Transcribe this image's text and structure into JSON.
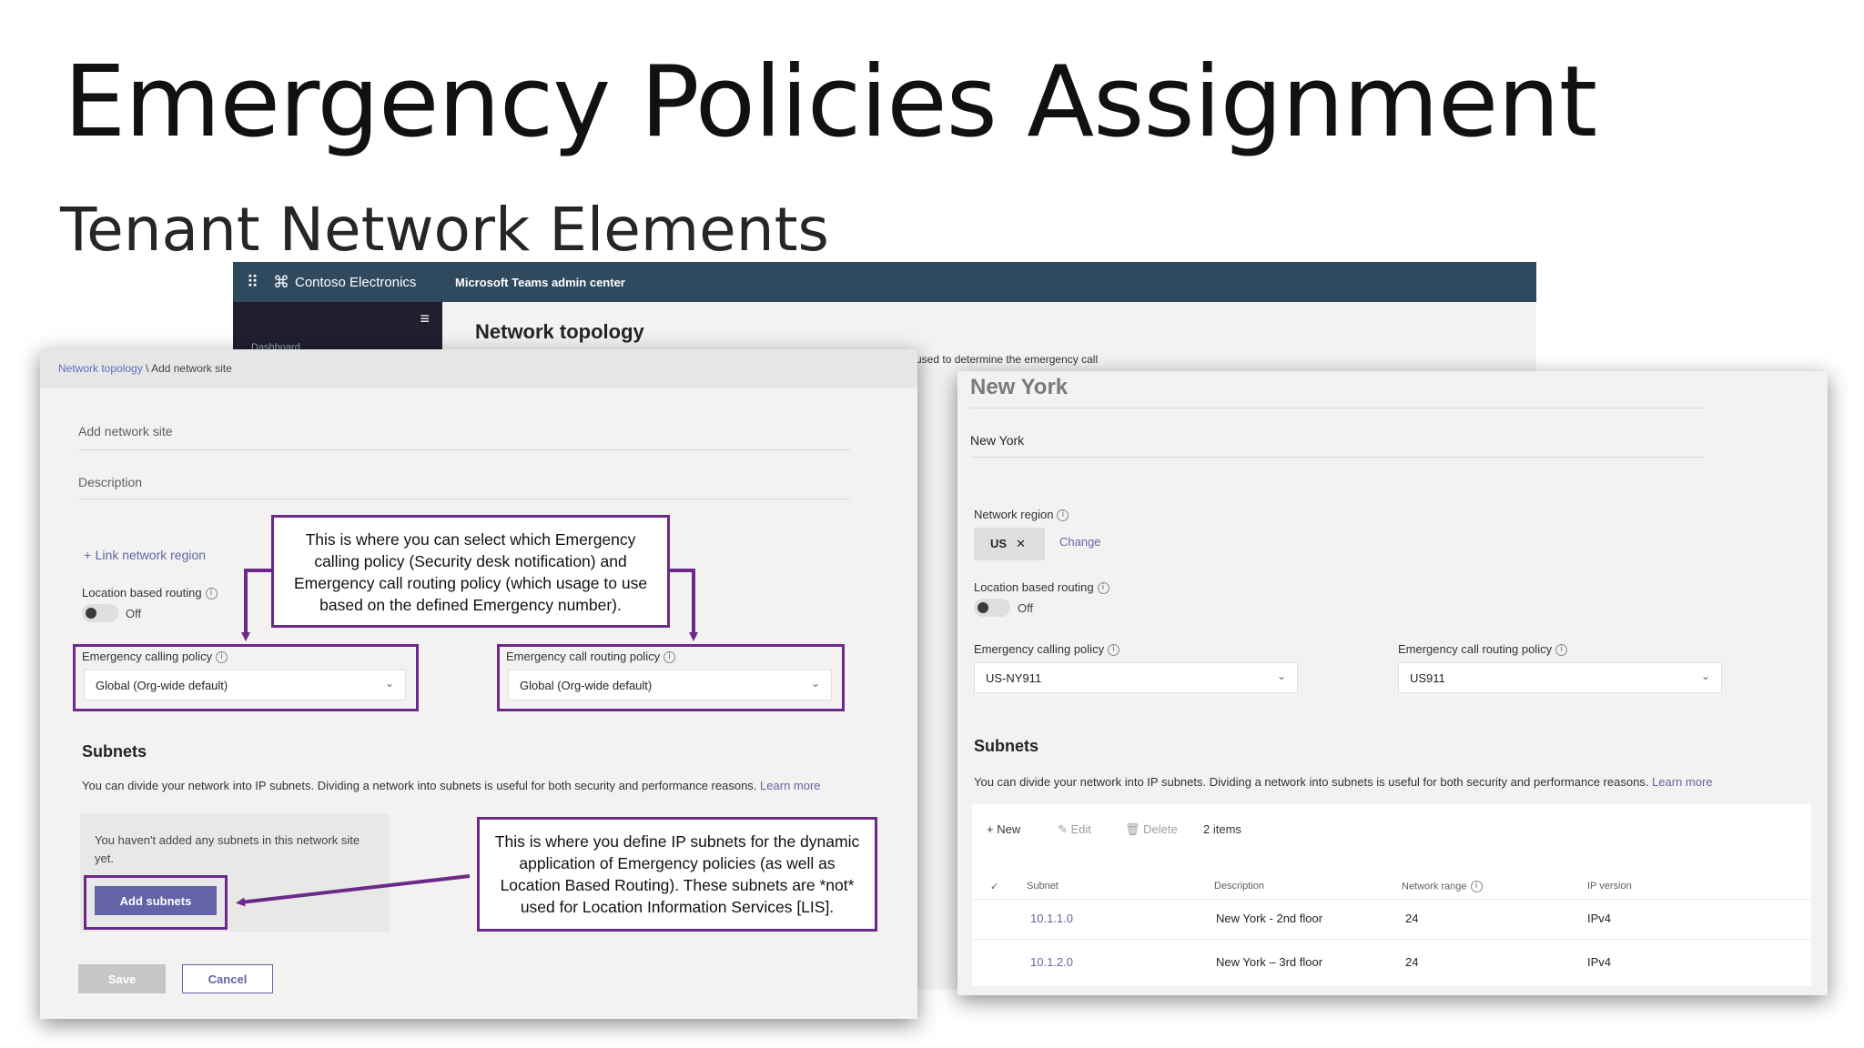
{
  "slide": {
    "title": "Emergency Policies Assignment",
    "subtitle": "Tenant Network Elements"
  },
  "admin_center": {
    "org_name": "Contoso Electronics",
    "app_name": "Microsoft Teams admin center",
    "page_title": "Network topology",
    "nav_peek": "Dashboard",
    "peek_text": "used to determine the emergency call"
  },
  "add_site": {
    "breadcrumb_parent": "Network topology",
    "breadcrumb_sep": " \\ ",
    "breadcrumb_current": "Add network site",
    "name_placeholder": "Add network site",
    "description_placeholder": "Description",
    "link_region_label": "Link network region",
    "location_routing_label": "Location based routing",
    "location_routing_state": "Off",
    "calling_policy_label": "Emergency calling policy",
    "calling_policy_value": "Global (Org-wide default)",
    "routing_policy_label": "Emergency call routing policy",
    "routing_policy_value": "Global (Org-wide default)",
    "subnets_heading": "Subnets",
    "subnets_description": "You can divide your network into IP subnets. Dividing a network into subnets is useful for both security and performance reasons.",
    "learn_more": "Learn more",
    "empty_message": "You haven't added any subnets in this network site yet.",
    "add_subnets_button": "Add subnets",
    "save_button": "Save",
    "cancel_button": "Cancel"
  },
  "callouts": {
    "policy_callout": "This is where you can select which Emergency calling policy (Security desk notification) and Emergency call routing policy (which usage to use based on the defined Emergency number).",
    "subnet_callout": "This is where you define IP subnets for the dynamic application of Emergency policies (as well as Location Based Routing). These subnets are *not* used for Location Information Services [LIS]."
  },
  "site_detail": {
    "title": "New York",
    "name_value": "New York",
    "network_region_label": "Network region",
    "region_value": "US",
    "change_link": "Change",
    "location_routing_label": "Location based routing",
    "location_routing_state": "Off",
    "calling_policy_label": "Emergency calling policy",
    "calling_policy_value": "US-NY911",
    "routing_policy_label": "Emergency call routing policy",
    "routing_policy_value": "US911",
    "subnets_heading": "Subnets",
    "subnets_description": "You can divide your network into IP subnets. Dividing a network into subnets is useful for both security and performance reasons.",
    "learn_more": "Learn more",
    "toolbar": {
      "new_label": "New",
      "edit_label": "Edit",
      "delete_label": "Delete",
      "items_count": "2 items"
    },
    "columns": [
      "Subnet",
      "Description",
      "Network range",
      "IP version"
    ],
    "rows": [
      {
        "subnet": "10.1.1.0",
        "description": "New York - 2nd floor",
        "range": "24",
        "ip_version": "IPv4"
      },
      {
        "subnet": "10.1.2.0",
        "description": "New York – 3rd floor",
        "range": "24",
        "ip_version": "IPv4"
      }
    ]
  },
  "colors": {
    "accent": "#6264a7",
    "callout_border": "#6b2a8a",
    "topbar": "#2f4a5e"
  }
}
